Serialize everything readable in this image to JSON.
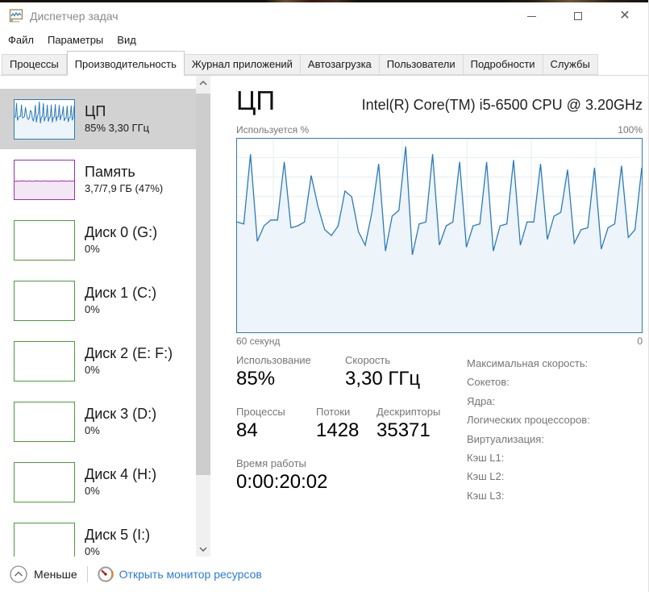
{
  "window": {
    "title": "Диспетчер задач"
  },
  "menu": {
    "items": [
      "Файл",
      "Параметры",
      "Вид"
    ]
  },
  "tabs": {
    "active": "Производительность",
    "items": [
      "Процессы",
      "Производительность",
      "Журнал приложений",
      "Автозагрузка",
      "Пользователи",
      "Подробности",
      "Службы"
    ]
  },
  "sidebar": {
    "items": [
      {
        "id": "cpu",
        "title": "ЦП",
        "subtitle": "85% 3,30 ГГц",
        "type": "cpu",
        "selected": true
      },
      {
        "id": "memory",
        "title": "Память",
        "subtitle": "3,7/7,9 ГБ (47%)",
        "type": "memory",
        "selected": false
      },
      {
        "id": "disk-0",
        "title": "Диск 0 (G:)",
        "subtitle": "0%",
        "type": "disk",
        "selected": false
      },
      {
        "id": "disk-1",
        "title": "Диск 1 (C:)",
        "subtitle": "0%",
        "type": "disk",
        "selected": false
      },
      {
        "id": "disk-2",
        "title": "Диск 2 (E: F:)",
        "subtitle": "0%",
        "type": "disk",
        "selected": false
      },
      {
        "id": "disk-3",
        "title": "Диск 3 (D:)",
        "subtitle": "0%",
        "type": "disk",
        "selected": false
      },
      {
        "id": "disk-4",
        "title": "Диск 4 (H:)",
        "subtitle": "0%",
        "type": "disk",
        "selected": false
      },
      {
        "id": "disk-5",
        "title": "Диск 5 (I:)",
        "subtitle": "0%",
        "type": "disk",
        "selected": false
      }
    ]
  },
  "main": {
    "title": "ЦП",
    "subtitle": "Intel(R) Core(TM) i5-6500 CPU @ 3.20GHz",
    "chart_top_left": "Используется %",
    "chart_top_right": "100%",
    "chart_bottom_left": "60 секунд",
    "chart_bottom_right": "0",
    "stats_row1": [
      {
        "label": "Использование",
        "value": "85%"
      },
      {
        "label": "Скорость",
        "value": "3,30 ГГц"
      }
    ],
    "stats_row2": [
      {
        "label": "Процессы",
        "value": "84"
      },
      {
        "label": "Потоки",
        "value": "1428"
      },
      {
        "label": "Дескрипторы",
        "value": "35371"
      }
    ],
    "uptime": {
      "label": "Время работы",
      "value": "0:00:20:02"
    },
    "right_info": [
      "Максимальная скорость:",
      "Сокетов:",
      "Ядра:",
      "Логических процессоров:",
      "Виртуализация:",
      "Кэш L1:",
      "Кэш L2:",
      "Кэш L3:"
    ]
  },
  "footer": {
    "less_label": "Меньше",
    "resmon_label": "Открыть монитор ресурсов"
  },
  "colors": {
    "cpu_line": "#2b7bb9",
    "cpu_border": "#2b7bb9",
    "cpu_fill": "#edf4fa",
    "grid": "#e3edf5",
    "memory_line": "#9a2fae",
    "memory_fill": "#f3e7f6",
    "disk_border": "#4a9c39",
    "link_blue": "#2b7cd3",
    "label_gray": "#767676",
    "selected_bg": "#d2d2d2"
  },
  "chart_data": {
    "type": "area",
    "title": "ЦП — Используется %",
    "xlabel": "60 секунд → 0",
    "ylabel": "%",
    "ylim": [
      0,
      100
    ],
    "x_span_seconds": 60,
    "grid": true,
    "cpu_percent": [
      57,
      56,
      92,
      47,
      55,
      58,
      58,
      88,
      54,
      55,
      57,
      81,
      65,
      53,
      50,
      55,
      73,
      70,
      52,
      45,
      62,
      87,
      42,
      60,
      63,
      96,
      40,
      56,
      57,
      92,
      45,
      55,
      57,
      88,
      44,
      55,
      56,
      88,
      42,
      55,
      56,
      89,
      45,
      57,
      57,
      87,
      48,
      60,
      62,
      84,
      46,
      53,
      54,
      85,
      43,
      54,
      56,
      86,
      49,
      53,
      85
    ],
    "memory_percent": [
      46,
      47,
      46.5,
      47,
      47.5,
      47,
      46.5,
      47,
      47,
      46,
      47,
      47.5,
      47,
      46.5,
      47,
      47,
      47.5,
      46.5,
      47,
      46.5,
      47,
      47,
      46,
      47,
      47.5,
      47,
      46.5,
      47,
      47,
      46.5,
      47
    ]
  }
}
